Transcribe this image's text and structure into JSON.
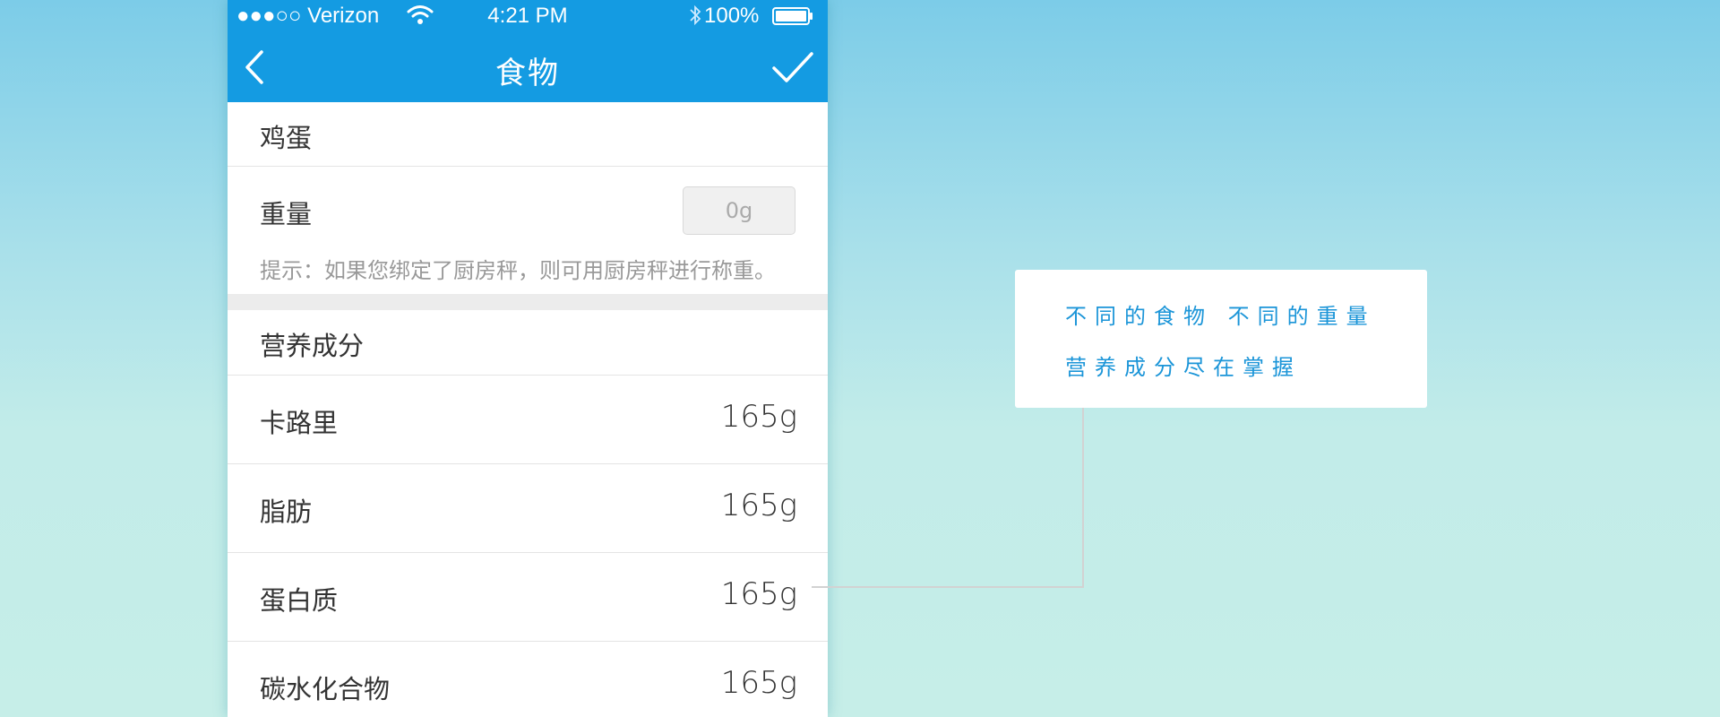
{
  "status_bar": {
    "carrier": "●●●○○ Verizon",
    "time": "4:21 PM",
    "battery": "100%"
  },
  "nav": {
    "title": "食物",
    "back_icon": "chevron-left-icon",
    "confirm_icon": "checkmark-icon"
  },
  "food": {
    "name": "鸡蛋"
  },
  "weight": {
    "label": "重量",
    "placeholder": "0g",
    "hint": "提示：如果您绑定了厨房秤，则可用厨房秤进行称重。"
  },
  "nutrition": {
    "header": "营养成分",
    "items": [
      {
        "label": "卡路里",
        "value": "165g"
      },
      {
        "label": "脂肪",
        "value": "165g"
      },
      {
        "label": "蛋白质",
        "value": "165g"
      },
      {
        "label": "碳水化合物",
        "value": "165g"
      }
    ]
  },
  "callout": {
    "line1": "不同的食物  不同的重量",
    "line2": "营养成分尽在掌握"
  },
  "colors": {
    "primary": "#149be2",
    "callout_text": "#1b95d8",
    "background_top": "#7ccce8",
    "background_bottom": "#c6eee8"
  }
}
